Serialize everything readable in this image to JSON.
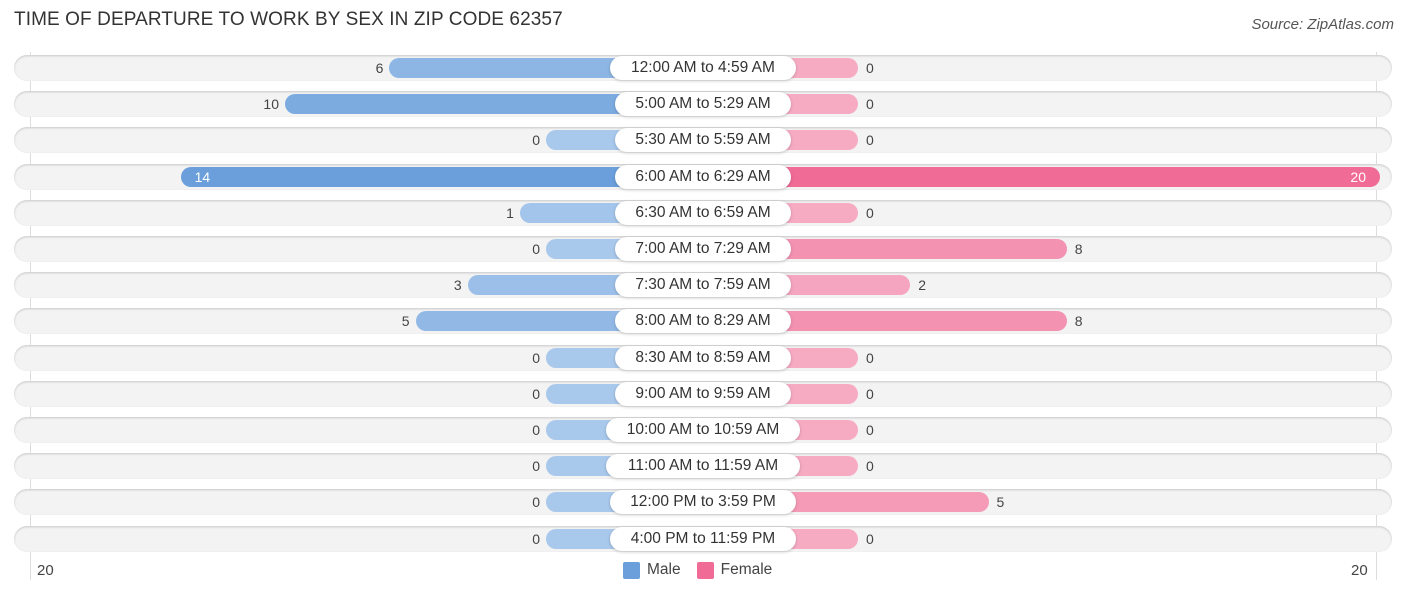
{
  "title": "TIME OF DEPARTURE TO WORK BY SEX IN ZIP CODE 62357",
  "source": "Source: ZipAtlas.com",
  "colors": {
    "male": "#6a9fdb",
    "male_light": "#a8c8ec",
    "female": "#f06c96",
    "female_light": "#f6abc3"
  },
  "chart_data": {
    "type": "bar",
    "orientation": "horizontal-diverging",
    "title": "TIME OF DEPARTURE TO WORK BY SEX IN ZIP CODE 62357",
    "categories": [
      "12:00 AM to 4:59 AM",
      "5:00 AM to 5:29 AM",
      "5:30 AM to 5:59 AM",
      "6:00 AM to 6:29 AM",
      "6:30 AM to 6:59 AM",
      "7:00 AM to 7:29 AM",
      "7:30 AM to 7:59 AM",
      "8:00 AM to 8:29 AM",
      "8:30 AM to 8:59 AM",
      "9:00 AM to 9:59 AM",
      "10:00 AM to 10:59 AM",
      "11:00 AM to 11:59 AM",
      "12:00 PM to 3:59 PM",
      "4:00 PM to 11:59 PM"
    ],
    "series": [
      {
        "name": "Male",
        "values": [
          6,
          10,
          0,
          14,
          1,
          0,
          3,
          5,
          0,
          0,
          0,
          0,
          0,
          0
        ]
      },
      {
        "name": "Female",
        "values": [
          0,
          0,
          0,
          20,
          0,
          8,
          2,
          8,
          0,
          0,
          0,
          0,
          5,
          0
        ]
      }
    ],
    "axis": {
      "left_label": "20",
      "right_label": "20",
      "range": [
        -20,
        20
      ]
    },
    "legend": {
      "position": "bottom-center",
      "entries": [
        "Male",
        "Female"
      ]
    },
    "xlabel": "",
    "ylabel": ""
  }
}
